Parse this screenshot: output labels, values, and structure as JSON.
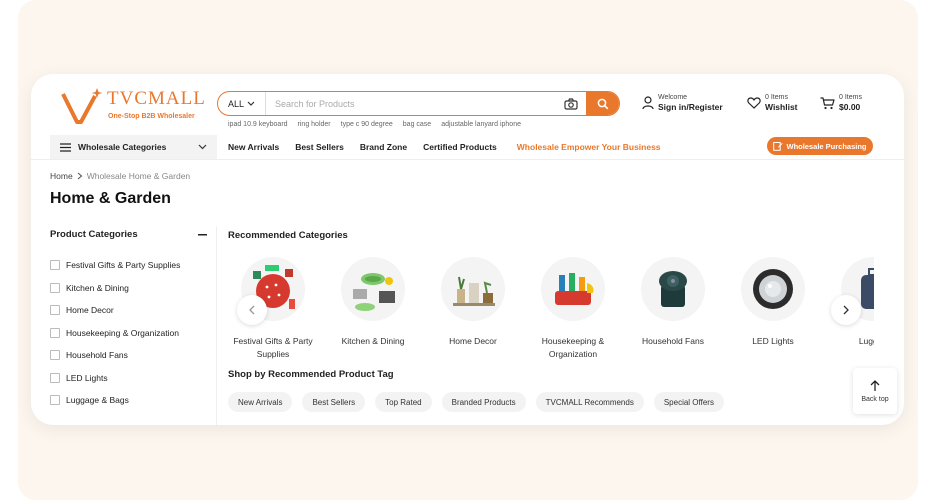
{
  "brand": {
    "name": "TVCMALL",
    "tagline": "One-Stop B2B Wholesaler",
    "accent": "#e9782d"
  },
  "search": {
    "category": "ALL",
    "placeholder": "Search for Products"
  },
  "hot_searches": [
    "ipad 10.9 keyboard",
    "ring holder",
    "type c 90 degree",
    "bag case",
    "adjustable lanyard iphone"
  ],
  "account": {
    "welcome": "Welcome",
    "signin": "Sign in/Register"
  },
  "wishlist": {
    "count": "0 Items",
    "label": "Wishlist"
  },
  "cart": {
    "count": "0 Items",
    "total": "$0.00"
  },
  "nav": {
    "categories": "Wholesale Categories",
    "links": [
      "New Arrivals",
      "Best Sellers",
      "Brand Zone",
      "Certified Products"
    ],
    "highlight": "Wholesale Empower Your Business",
    "button": "Wholesale Purchasing"
  },
  "breadcrumb": {
    "home": "Home",
    "current": "Wholesale Home & Garden"
  },
  "page_title": "Home & Garden",
  "sidebar": {
    "title": "Product Categories",
    "items": [
      "Festival Gifts & Party Supplies",
      "Kitchen & Dining",
      "Home Decor",
      "Housekeeping & Organization",
      "Household Fans",
      "LED Lights",
      "Luggage & Bags"
    ]
  },
  "recommended": {
    "title": "Recommended Categories",
    "items": [
      "Festival Gifts & Party Supplies",
      "Kitchen & Dining",
      "Home Decor",
      "Housekeeping & Organization",
      "Household Fans",
      "LED Lights",
      "Luggag"
    ]
  },
  "tags": {
    "title": "Shop by Recommended Product Tag",
    "items": [
      "New Arrivals",
      "Best Sellers",
      "Top Rated",
      "Branded Products",
      "TVCMALL Recommends",
      "Special Offers"
    ]
  },
  "back_top": "Back top"
}
